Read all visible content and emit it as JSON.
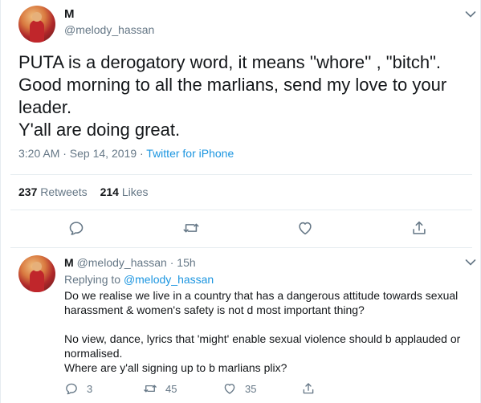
{
  "tweet": {
    "name": "M",
    "handle": "@melody_hassan",
    "text_lines": [
      "PUTA is a derogatory word, it means ''whore'' , \"bitch\".",
      "Good morning to all the marlians, send my love to your",
      "leader.",
      "Y'all are doing great."
    ],
    "timestamp": "3:20 AM · Sep 14, 2019 · ",
    "source": "Twitter for iPhone",
    "retweets_count": "237",
    "retweets_label": "Retweets",
    "likes_count": "214",
    "likes_label": "Likes"
  },
  "reply": {
    "name": "M",
    "handle_time": "@melody_hassan · 15h",
    "replying_prefix": "Replying to ",
    "replying_to": "@melody_hassan",
    "text_lines": [
      "Do we realise we live in a country that has a dangerous attitude towards sexual",
      "harassment & women's safety is not d most important thing?",
      "",
      "No view, dance, lyrics that 'might' enable sexual violence should b applauded or",
      "normalised.",
      "Where are y'all signing up to b marlians plix?"
    ],
    "reply_count": "3",
    "retweet_count": "45",
    "like_count": "35"
  },
  "icons": {
    "reply": "reply-icon",
    "retweet": "retweet-icon",
    "like": "heart-icon",
    "share": "share-icon",
    "more": "chevron-down-icon"
  },
  "colors": {
    "text": "#14171a",
    "secondary": "#657786",
    "link": "#1b95e0",
    "border": "#e6ecf0"
  }
}
